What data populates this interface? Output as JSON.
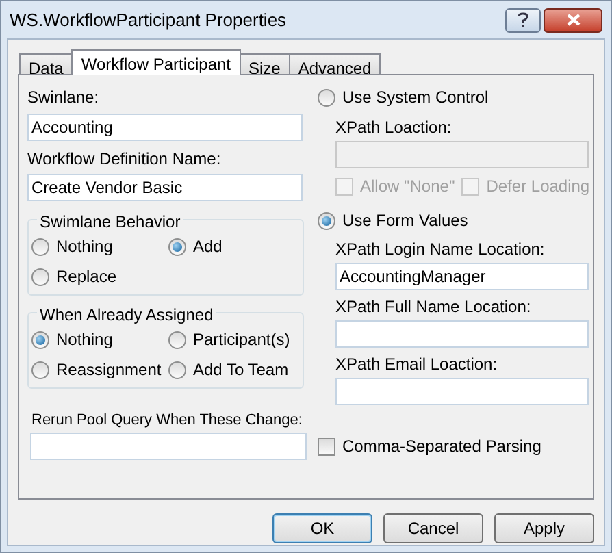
{
  "window": {
    "title": "WS.WorkflowParticipant Properties"
  },
  "tabs": [
    {
      "label": "Data",
      "selected": false
    },
    {
      "label": "Workflow Participant",
      "selected": true
    },
    {
      "label": "Size",
      "selected": false
    },
    {
      "label": "Advanced",
      "selected": false
    }
  ],
  "left": {
    "swimlane_label": "Swinlane:",
    "swimlane_value": "Accounting",
    "definition_label": "Workflow Definition Name:",
    "definition_value": "Create Vendor Basic",
    "groups": [
      {
        "title": "Swimlane Behavior",
        "options": [
          {
            "label": "Nothing",
            "selected": false
          },
          {
            "label": "Add",
            "selected": true
          },
          {
            "label": "Replace",
            "selected": false
          }
        ]
      },
      {
        "title": "When Already Assigned",
        "options": [
          {
            "label": "Nothing",
            "selected": true
          },
          {
            "label": "Participant(s)",
            "selected": false
          },
          {
            "label": "Reassignment",
            "selected": false
          },
          {
            "label": "Add To Team",
            "selected": false
          }
        ]
      }
    ],
    "rerun_label": "Rerun Pool Query When These Change:"
  },
  "right": {
    "system_control": {
      "label": "Use System Control",
      "selected": false
    },
    "xpath_location_label": "XPath Loaction:",
    "checkboxes": [
      {
        "label": "Allow \"None\"",
        "checked": false,
        "disabled": true
      },
      {
        "label": "Defer Loading",
        "checked": false,
        "disabled": true
      }
    ],
    "form_values": {
      "label": "Use Form Values",
      "selected": true
    },
    "fields": [
      {
        "label": "XPath Login Name Location:",
        "value": "AccountingManager"
      },
      {
        "label": "XPath Full Name Location:"
      },
      {
        "label": "XPath Email Loaction:"
      }
    ],
    "comma": {
      "label": "Comma-Separated Parsing",
      "checked": false
    }
  },
  "buttons": [
    {
      "label": "OK",
      "default": true
    },
    {
      "label": "Cancel",
      "default": false
    },
    {
      "label": "Apply",
      "default": false
    }
  ]
}
